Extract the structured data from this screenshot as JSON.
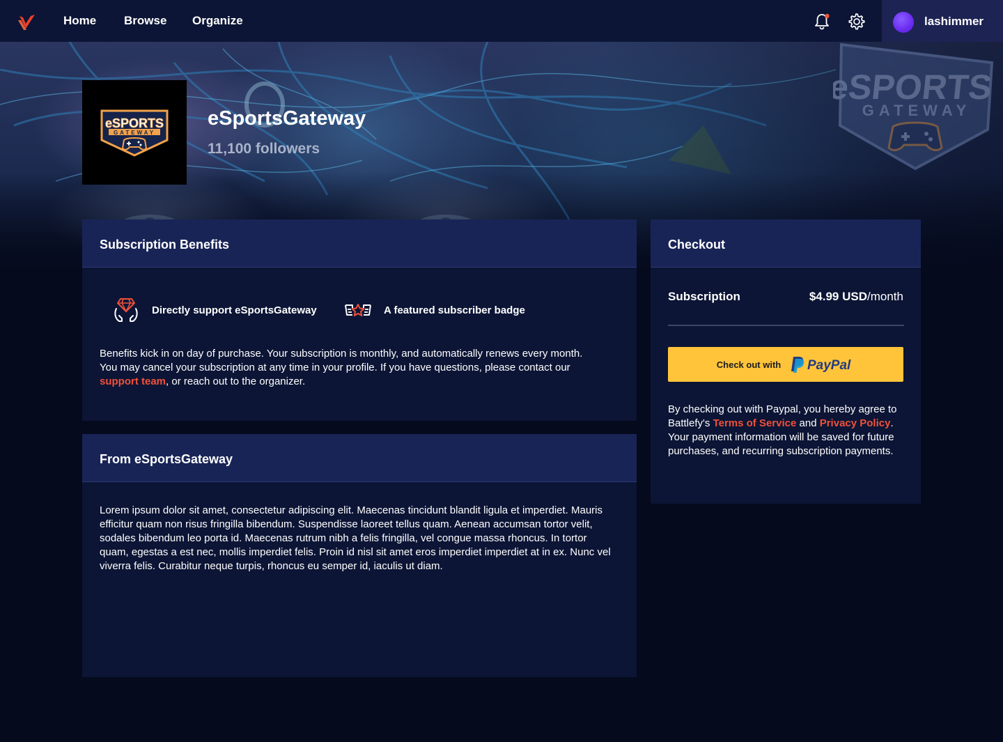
{
  "nav": {
    "logo_icon": "battlefy-logo-icon",
    "links": [
      "Home",
      "Browse",
      "Organize"
    ],
    "notification_icon": "bell-icon",
    "settings_icon": "gear-icon",
    "username": "lashimmer"
  },
  "organizer": {
    "name": "eSportsGateway",
    "followers": "11,100 followers",
    "logo_text_top": "eSPORTS",
    "logo_text_bottom": "GATEWAY"
  },
  "benefits": {
    "title": "Subscription Benefits",
    "items": [
      {
        "icon": "gem-hands-icon",
        "label": "Directly support eSportsGateway"
      },
      {
        "icon": "star-badge-icon",
        "label": "A featured subscriber badge"
      }
    ],
    "description_before": "Benefits kick in on day of purchase. Your subscription is monthly, and automatically renews every month. You may cancel your subscription at any time in your profile. If you have questions, please contact our ",
    "description_link": "support team",
    "description_after": ", or reach out to the organizer."
  },
  "from": {
    "title": "From eSportsGateway",
    "body": "Lorem ipsum dolor sit amet, consectetur adipiscing elit. Maecenas tincidunt blandit ligula et imperdiet. Mauris efficitur quam non risus fringilla bibendum. Suspendisse laoreet tellus quam. Aenean accumsan tortor velit, sodales bibendum leo porta id. Maecenas rutrum nibh a felis fringilla, vel congue massa rhoncus. In tortor quam, egestas a est nec, mollis imperdiet felis. Proin id nisl sit amet eros imperdiet imperdiet at in ex. Nunc vel viverra felis. Curabitur neque turpis, rhoncus eu semper id, iaculis ut diam."
  },
  "checkout": {
    "title": "Checkout",
    "subscription_label": "Subscription",
    "price": "$4.99 USD",
    "period": "/month",
    "button_prefix": "Check out with",
    "button_brand": "PayPal",
    "note_1": "By checking out with Paypal, you hereby agree to Battlefy's ",
    "terms_link": "Terms of Service",
    "note_2": " and ",
    "privacy_link": "Privacy Policy",
    "note_3": ". Your payment information will be saved for future purchases, and recurring subscription payments."
  },
  "colors": {
    "accent": "#f0513b",
    "nav_bg": "#0c1535",
    "card_bg": "#0c1535",
    "card_header_bg": "#192456",
    "paypal_yellow": "#ffc43a",
    "logo_orange": "#f2a24a"
  }
}
